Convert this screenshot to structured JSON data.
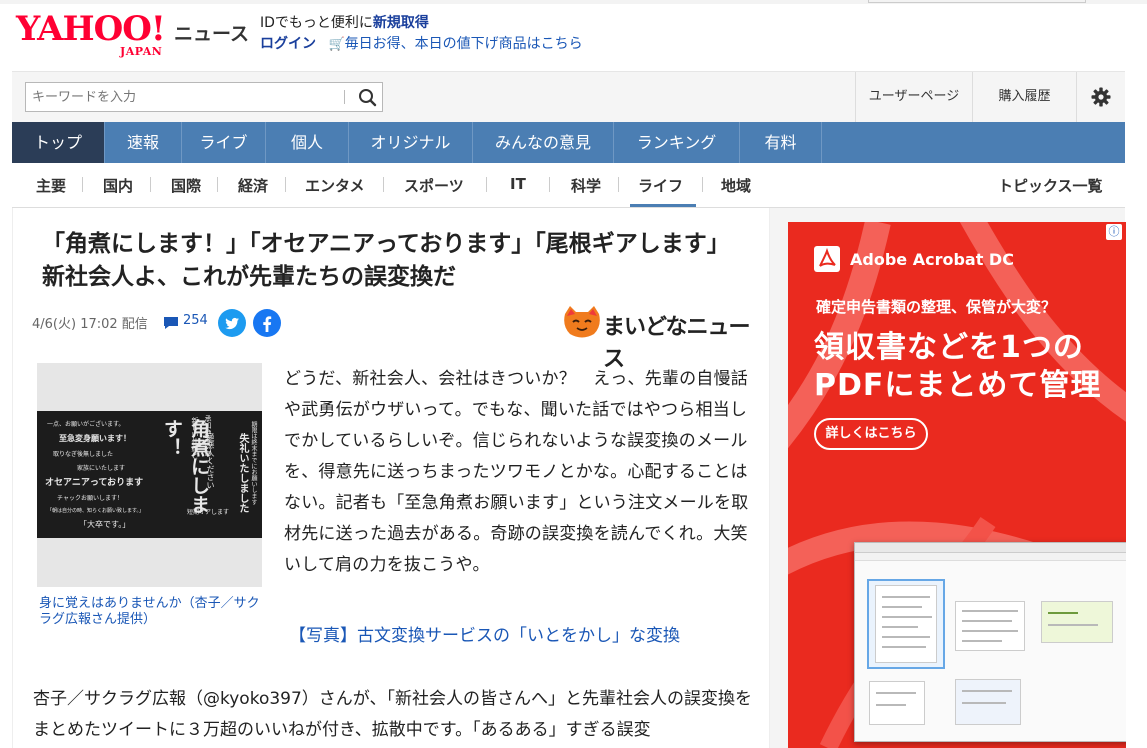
{
  "header": {
    "logo_yahoo": "YAHOO!",
    "logo_japan": "JAPAN",
    "logo_news": "ニュース",
    "promo_line1_prefix": "IDでもっと便利に",
    "promo_line1_link": "新規取得",
    "login": "ログイン",
    "deal_link": "毎日お得、本日の値下げ商品はこちら"
  },
  "search": {
    "placeholder": "キーワードを入力",
    "user_page": "ユーザーページ",
    "history": "購入履歴"
  },
  "main_nav": [
    "トップ",
    "速報",
    "ライブ",
    "個人",
    "オリジナル",
    "みんなの意見",
    "ランキング",
    "有料"
  ],
  "sub_nav": [
    "主要",
    "国内",
    "国際",
    "経済",
    "エンタメ",
    "スポーツ",
    "IT",
    "科学",
    "ライフ",
    "地域"
  ],
  "topics_list": "トピックス一覧",
  "article": {
    "title": "「角煮にします！」「オセアニアっております」「尾根ギアします」　新社会人よ、これが先輩たちの誤変換だ",
    "date": "4/6(火) 17:02 配信",
    "comment_count": "254",
    "publisher": "まいどなニュース",
    "photo_caption": "身に覚えはありませんか（杏子／サクラグ広報さん提供）",
    "body": "どうだ、新社会人、会社はきついか？　えっ、先輩の自慢話や武勇伝がウザいって。でもな、聞いた話ではやつら相当しでかしているらしいぞ。信じられないような誤変換のメールを、得意先に送っちまったツワモノとかな。心配することはない。記者も「至急角煮お願います」という注文メールを取材先に送った過去がある。奇跡の誤変換を読んでくれ。大笑いして肩の力を抜こうや。",
    "photo_link": "【写真】古文変換サービスの「いとをかし」な変換",
    "body2": "杏子／サクラグ広報（@kyoko397）さんが、「新社会人の皆さんへ」と先輩社会人の誤変換をまとめたツイートに３万超のいいねが付き、拡散中です。「あるある」すぎる誤変"
  },
  "ad": {
    "brand": "Adobe Acrobat DC",
    "subhead": "確定申告書類の整理、保管が大変？",
    "headline_1": "領収書などを1つの",
    "headline_2": "PDFにまとめて管理",
    "cta": "詳しくはこちら"
  },
  "colors": {
    "brand_red": "#ff0033",
    "nav_blue": "#4b7eb3",
    "nav_active": "#2b3d57",
    "link_blue": "#1a57b6",
    "ad_red": "#ea2a1f"
  }
}
